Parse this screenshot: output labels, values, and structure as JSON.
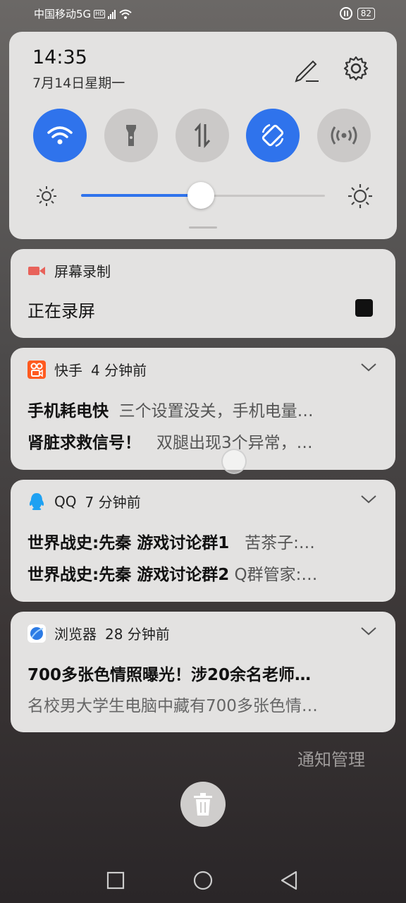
{
  "status_bar": {
    "carrier": "中国移动5G",
    "hd": "HD",
    "network": "5G",
    "battery": "82"
  },
  "quick_settings": {
    "time": "14:35",
    "date": "7月14日星期一",
    "tiles": [
      {
        "name": "wifi",
        "icon": "wifi-icon",
        "active": true
      },
      {
        "name": "flashlight",
        "icon": "flashlight-icon",
        "active": false
      },
      {
        "name": "mobile-data",
        "icon": "data-arrows-icon",
        "active": false
      },
      {
        "name": "auto-rotate",
        "icon": "rotate-icon",
        "active": true
      },
      {
        "name": "hotspot",
        "icon": "hotspot-icon",
        "active": false
      }
    ],
    "brightness_level": 0.49,
    "accent_color": "#2f73ec"
  },
  "notifications": [
    {
      "app": "屏幕录制",
      "icon": "video-camera-icon",
      "title": "正在录屏"
    },
    {
      "app": "快手",
      "time": "4 分钟前",
      "icon": "kuaishou-icon",
      "lines": [
        {
          "title": "手机耗电快",
          "text": "三个设置没关，手机电量…"
        },
        {
          "title": "肾脏求救信号！",
          "text": "双腿出现3个异常，…"
        }
      ]
    },
    {
      "app": "QQ",
      "time": "7 分钟前",
      "icon": "qq-icon",
      "lines": [
        {
          "title": "世界战史:先秦 游戏讨论群1",
          "text": "苦茶子:…"
        },
        {
          "title": "世界战史:先秦 游戏讨论群2",
          "text": "Q群管家:…"
        }
      ]
    },
    {
      "app": "浏览器",
      "time": "28 分钟前",
      "icon": "browser-icon",
      "title": "700多张色情照曝光！涉20余名老师…",
      "text": "名校男大学生电脑中藏有700多张色情…"
    }
  ],
  "notification_management": "通知管理"
}
